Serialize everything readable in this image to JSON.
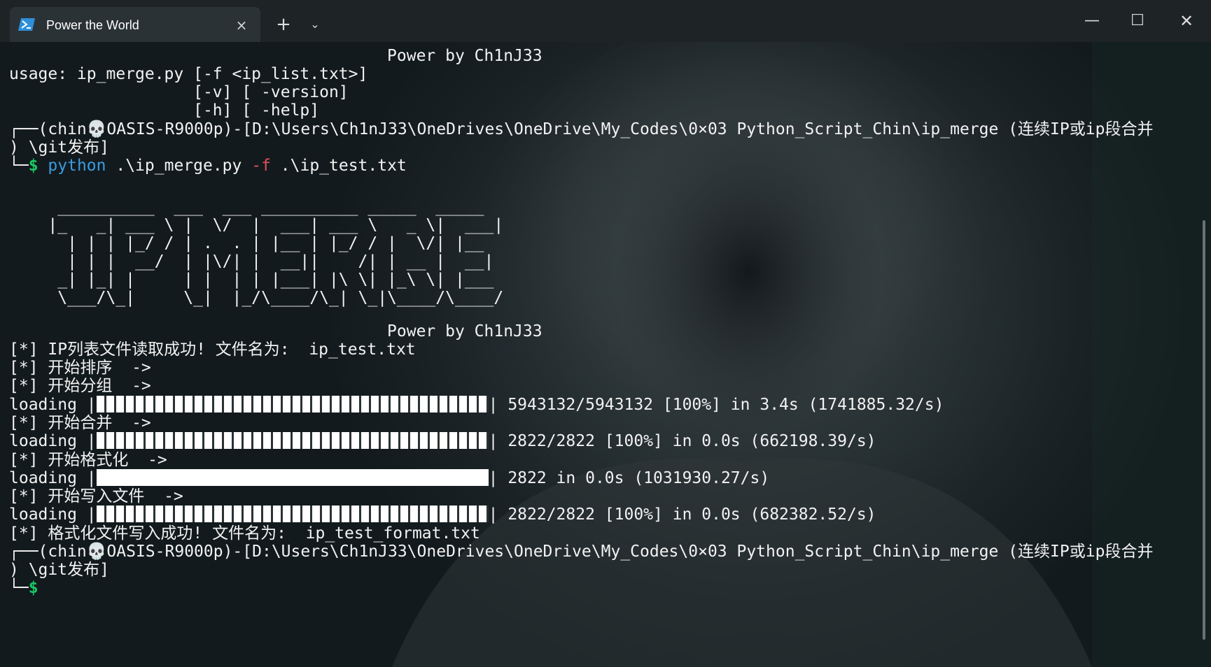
{
  "window": {
    "tab_title": "Power the World",
    "tab_icon": "powershell-icon",
    "close_tab_icon": "×",
    "new_tab_icon": "+",
    "tab_menu_icon": "⌄",
    "minimize_icon": "—",
    "maximize_icon": "☐",
    "close_icon": "✕"
  },
  "colors": {
    "command": "#3b9be0",
    "flag": "#e0505a",
    "prompt": "#17c964",
    "text": "#f2f2f2"
  },
  "terminal": {
    "banner_top": "                                       Power by Ch1nJ33",
    "usage_1": "usage: ip_merge.py [-f <ip_list.txt>]",
    "usage_2": "                   [-v] [ -version]",
    "usage_3": "                   [-h] [ -help]",
    "prompt1_a": "┌──(chin💀OASIS-R9000p)-[D:\\Users\\Ch1nJ33\\OneDrives\\OneDrive\\My_Codes\\0×03 Python_Script_Chin\\ip_merge (连续IP或ip段合并",
    "prompt1_b": ") \\git发布]",
    "prompt1_tail": "└─",
    "prompt_symbol": "$",
    "cmd_name": "python",
    "cmd_script": " .\\ip_merge.py ",
    "cmd_flag": "-f",
    "cmd_arg": " .\\ip_test.txt",
    "art_1": "     __________  ___  ___ __________ _____  _____",
    "art_2": "    |_   _| ___ \\ |  \\/  |  ___| ___ \\   _ \\|  ___|",
    "art_3": "      | | | |_/ / | .  . | |__ | |_/ / |  \\/| |__",
    "art_4": "      | | |  __/  | |\\/| |  __||    /| | __ |  __|",
    "art_5": "     _| |_| |     | |  | | |___| |\\ \\| |_\\ \\| |___",
    "art_6": "     \\___/\\_|     \\_|  |_/\\____/\\_| \\_|\\____/\\____/",
    "banner_bottom": "                                       Power by Ch1nJ33",
    "msg_read": "[*] IP列表文件读取成功! 文件名为:  ip_test.txt",
    "msg_sort": "[*] 开始排序  ->",
    "msg_group": "[*] 开始分组  ->",
    "load1_prefix": "loading |",
    "load1_suffix": "| 5943132/5943132 [100%] in 3.4s (1741885.32/s)",
    "msg_merge": "[*] 开始合并  ->",
    "load2_prefix": "loading |",
    "load2_suffix": "| 2822/2822 [100%] in 0.0s (662198.39/s)",
    "msg_format": "[*] 开始格式化  ->",
    "load3_prefix": "loading |",
    "load3_suffix": "| 2822 in 0.0s (1031930.27/s)",
    "msg_write": "[*] 开始写入文件  ->",
    "load4_prefix": "loading |",
    "load4_suffix": "| 2822/2822 [100%] in 0.0s (682382.52/s)",
    "msg_done": "[*] 格式化文件写入成功! 文件名为:  ip_test_format.txt",
    "prompt2_a": "┌──(chin💀OASIS-R9000p)-[D:\\Users\\Ch1nJ33\\OneDrives\\OneDrive\\My_Codes\\0×03 Python_Script_Chin\\ip_merge (连续IP或ip段合并",
    "prompt2_b": ") \\git发布]",
    "prompt2_tail": "└─",
    "prompt2_symbol": "$"
  },
  "progress": {
    "load1": 1.0,
    "load2": 1.0,
    "load3": 1.0,
    "load4": 1.0
  }
}
